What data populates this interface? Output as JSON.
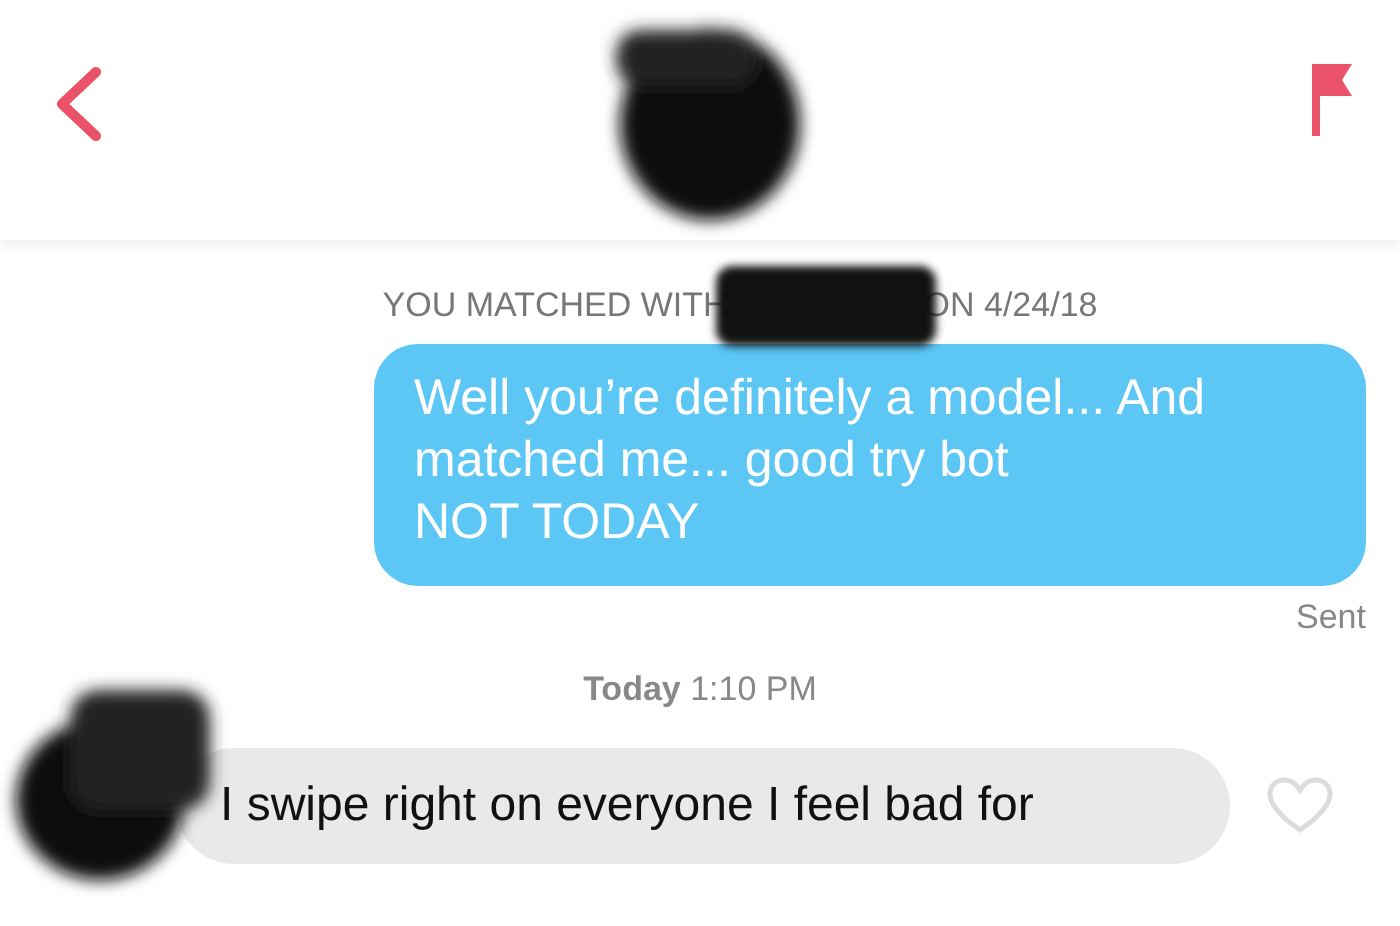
{
  "match_notice": {
    "prefix": "YOU MATCHED WITH",
    "suffix": "ON 4/24/18"
  },
  "messages": [
    {
      "kind": "sent",
      "lines": [
        "Well you’re definitely a model... And matched me... good try bot",
        "NOT TODAY"
      ],
      "status": "Sent"
    },
    {
      "kind": "timestamp",
      "day": "Today",
      "time": "1:10 PM"
    },
    {
      "kind": "received",
      "text": "I swipe right on everyone I feel bad for",
      "liked": false
    }
  ]
}
